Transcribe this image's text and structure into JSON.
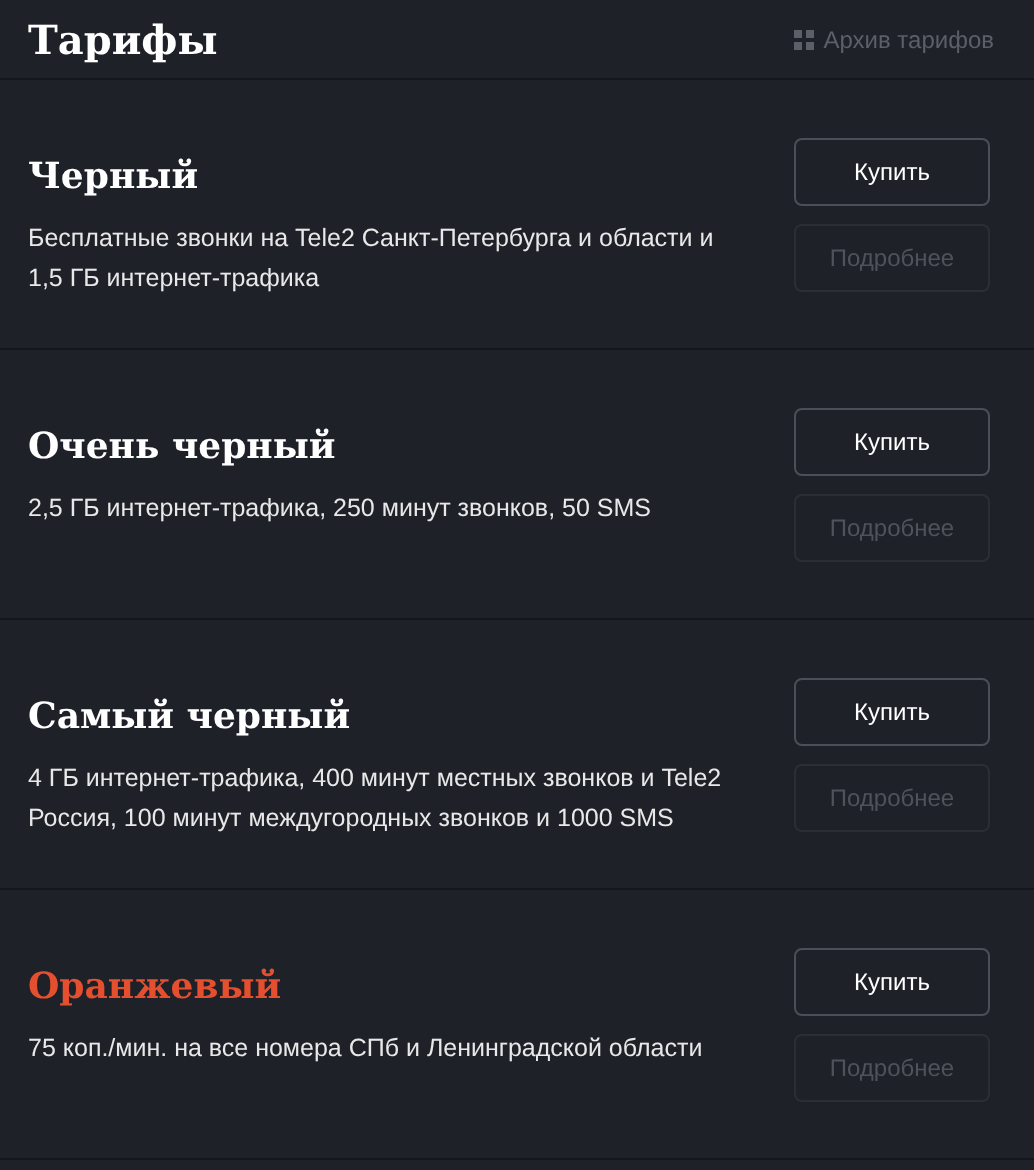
{
  "header": {
    "title": "Тарифы",
    "archive_link": "Архив тарифов"
  },
  "tariffs": [
    {
      "name": "Черный",
      "color": "#ffffff",
      "description": "Бесплатные звонки на Tele2 Санкт-Петербурга и области и 1,5 ГБ интернет-трафика",
      "buy": {
        "label": "Купить",
        "disabled": false
      },
      "details": {
        "label": "Подробнее",
        "disabled": true
      }
    },
    {
      "name": "Очень черный",
      "color": "#ffffff",
      "description": "2,5 ГБ интернет-трафика, 250 минут звонков, 50 SMS",
      "buy": {
        "label": "Купить",
        "disabled": false
      },
      "details": {
        "label": "Подробнее",
        "disabled": true
      }
    },
    {
      "name": "Самый черный",
      "color": "#ffffff",
      "description": "4 ГБ интернет-трафика, 400 минут местных звонков и Tele2 Россия, 100 минут междугородных звонков и 1000 SMS",
      "buy": {
        "label": "Купить",
        "disabled": false
      },
      "details": {
        "label": "Подробнее",
        "disabled": true
      }
    },
    {
      "name": "Оранжевый",
      "color": "#e4502f",
      "description": "75 коп./мин. на все номера СПб и Ленинградской области",
      "buy": {
        "label": "Купить",
        "disabled": false
      },
      "details": {
        "label": "Подробнее",
        "disabled": true
      }
    }
  ]
}
